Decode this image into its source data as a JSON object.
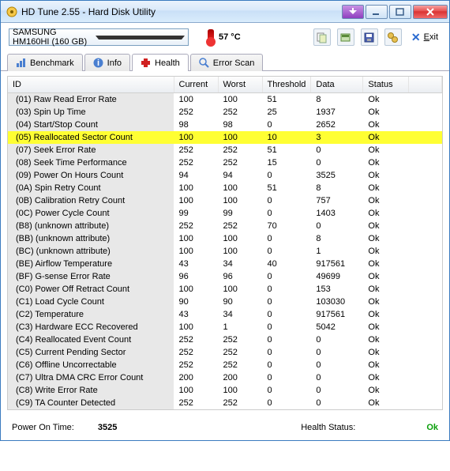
{
  "window": {
    "title": "HD Tune 2.55 - Hard Disk Utility"
  },
  "toolbar": {
    "drive": "SAMSUNG HM160HI (160 GB)",
    "temp": "57 °C",
    "exit": "Exit"
  },
  "tabs": {
    "benchmark": "Benchmark",
    "info": "Info",
    "health": "Health",
    "errorscan": "Error Scan"
  },
  "columns": {
    "id": "ID",
    "current": "Current",
    "worst": "Worst",
    "threshold": "Threshold",
    "data": "Data",
    "status": "Status"
  },
  "rows": [
    {
      "id": "(01) Raw Read Error Rate",
      "cur": "100",
      "wor": "100",
      "thr": "51",
      "dat": "8",
      "sta": "Ok"
    },
    {
      "id": "(03) Spin Up Time",
      "cur": "252",
      "wor": "252",
      "thr": "25",
      "dat": "1937",
      "sta": "Ok"
    },
    {
      "id": "(04) Start/Stop Count",
      "cur": "98",
      "wor": "98",
      "thr": "0",
      "dat": "2652",
      "sta": "Ok"
    },
    {
      "id": "(05) Reallocated Sector Count",
      "cur": "100",
      "wor": "100",
      "thr": "10",
      "dat": "3",
      "sta": "Ok",
      "hl": true
    },
    {
      "id": "(07) Seek Error Rate",
      "cur": "252",
      "wor": "252",
      "thr": "51",
      "dat": "0",
      "sta": "Ok"
    },
    {
      "id": "(08) Seek Time Performance",
      "cur": "252",
      "wor": "252",
      "thr": "15",
      "dat": "0",
      "sta": "Ok"
    },
    {
      "id": "(09) Power On Hours Count",
      "cur": "94",
      "wor": "94",
      "thr": "0",
      "dat": "3525",
      "sta": "Ok"
    },
    {
      "id": "(0A) Spin Retry Count",
      "cur": "100",
      "wor": "100",
      "thr": "51",
      "dat": "8",
      "sta": "Ok"
    },
    {
      "id": "(0B) Calibration Retry Count",
      "cur": "100",
      "wor": "100",
      "thr": "0",
      "dat": "757",
      "sta": "Ok"
    },
    {
      "id": "(0C) Power Cycle Count",
      "cur": "99",
      "wor": "99",
      "thr": "0",
      "dat": "1403",
      "sta": "Ok"
    },
    {
      "id": "(B8) (unknown attribute)",
      "cur": "252",
      "wor": "252",
      "thr": "70",
      "dat": "0",
      "sta": "Ok"
    },
    {
      "id": "(BB) (unknown attribute)",
      "cur": "100",
      "wor": "100",
      "thr": "0",
      "dat": "8",
      "sta": "Ok"
    },
    {
      "id": "(BC) (unknown attribute)",
      "cur": "100",
      "wor": "100",
      "thr": "0",
      "dat": "1",
      "sta": "Ok"
    },
    {
      "id": "(BE) Airflow Temperature",
      "cur": "43",
      "wor": "34",
      "thr": "40",
      "dat": "917561",
      "sta": "Ok"
    },
    {
      "id": "(BF) G-sense Error Rate",
      "cur": "96",
      "wor": "96",
      "thr": "0",
      "dat": "49699",
      "sta": "Ok"
    },
    {
      "id": "(C0) Power Off Retract Count",
      "cur": "100",
      "wor": "100",
      "thr": "0",
      "dat": "153",
      "sta": "Ok"
    },
    {
      "id": "(C1) Load Cycle Count",
      "cur": "90",
      "wor": "90",
      "thr": "0",
      "dat": "103030",
      "sta": "Ok"
    },
    {
      "id": "(C2) Temperature",
      "cur": "43",
      "wor": "34",
      "thr": "0",
      "dat": "917561",
      "sta": "Ok"
    },
    {
      "id": "(C3) Hardware ECC Recovered",
      "cur": "100",
      "wor": "1",
      "thr": "0",
      "dat": "5042",
      "sta": "Ok"
    },
    {
      "id": "(C4) Reallocated Event Count",
      "cur": "252",
      "wor": "252",
      "thr": "0",
      "dat": "0",
      "sta": "Ok"
    },
    {
      "id": "(C5) Current Pending Sector",
      "cur": "252",
      "wor": "252",
      "thr": "0",
      "dat": "0",
      "sta": "Ok"
    },
    {
      "id": "(C6) Offline Uncorrectable",
      "cur": "252",
      "wor": "252",
      "thr": "0",
      "dat": "0",
      "sta": "Ok"
    },
    {
      "id": "(C7) Ultra DMA CRC Error Count",
      "cur": "200",
      "wor": "200",
      "thr": "0",
      "dat": "0",
      "sta": "Ok"
    },
    {
      "id": "(C8) Write Error Rate",
      "cur": "100",
      "wor": "100",
      "thr": "0",
      "dat": "0",
      "sta": "Ok"
    },
    {
      "id": "(C9) TA Counter Detected",
      "cur": "252",
      "wor": "252",
      "thr": "0",
      "dat": "0",
      "sta": "Ok"
    }
  ],
  "footer": {
    "power_on_label": "Power On Time:",
    "power_on_value": "3525",
    "health_label": "Health Status:",
    "health_value": "Ok"
  }
}
